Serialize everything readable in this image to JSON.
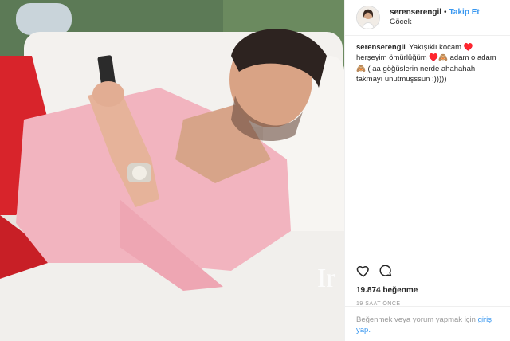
{
  "post": {
    "username": "serenserengil",
    "follow_label": "Takip Et",
    "location": "Göcek",
    "caption_text": "Yakışıklı kocam ♥️ herşeyim ömürlüğüm ♥️🙈 adam o adam 🙈 ( aa göğüslerin nerde ahahahah takmayı unutmuşssun :)))))",
    "likes": "19.874 beğenme",
    "time": "19 SAAT ÖNCE",
    "login_prompt_text": "Beğenmek veya yorum yapmak için",
    "login_link": "giriş yap."
  },
  "icons": {
    "like": "heart-icon",
    "comment": "comment-icon"
  },
  "colors": {
    "accent": "#3897f0",
    "shirt": "#f2b4bf",
    "cushion": "#f4f2ef",
    "shorts": "#d8242b"
  }
}
